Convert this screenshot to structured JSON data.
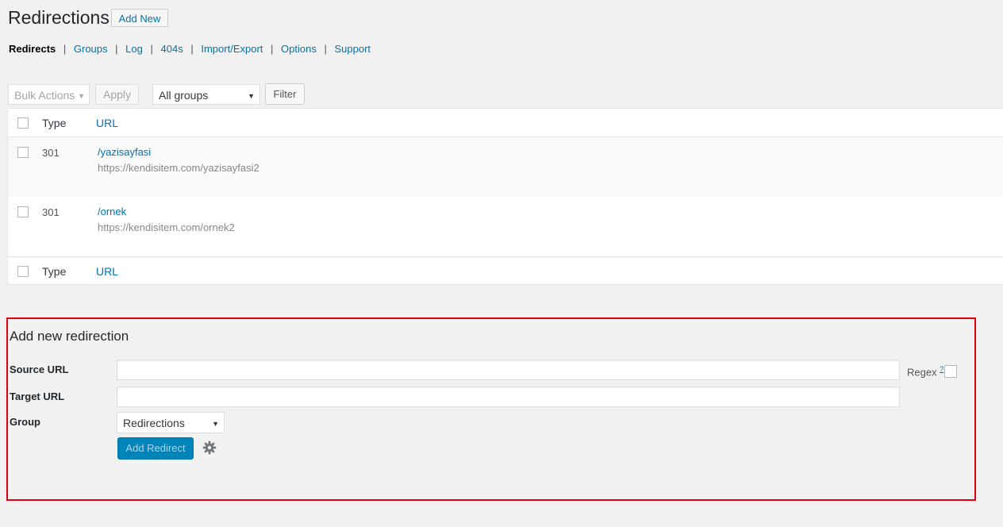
{
  "header": {
    "title": "Redirections",
    "add_new_label": "Add New"
  },
  "subnav": {
    "current": "Redirects",
    "links": [
      "Groups",
      "Log",
      "404s",
      "Import/Export",
      "Options",
      "Support"
    ],
    "separator": "|"
  },
  "tablenav": {
    "bulk_actions": "Bulk Actions",
    "apply_label": "Apply",
    "groups_selected": "All groups",
    "filter_label": "Filter"
  },
  "table": {
    "columns": {
      "type": "Type",
      "url": "URL"
    },
    "rows": [
      {
        "type": "301",
        "source": "/yazisayfasi",
        "target": "https://kendisitem.com/yazisayfasi2"
      },
      {
        "type": "301",
        "source": "/ornek",
        "target": "https://kendisitem.com/ornek2"
      }
    ]
  },
  "add_form": {
    "title": "Add new redirection",
    "source_label": "Source URL",
    "target_label": "Target URL",
    "group_label": "Group",
    "regex_label": "Regex",
    "regex_help": "?",
    "group_selected": "Redirections",
    "submit_label": "Add Redirect",
    "source_value": "",
    "target_value": ""
  },
  "icons": {
    "dropdown": "chevron-down-icon",
    "settings": "gear-icon"
  },
  "colors": {
    "link": "#0073aa",
    "primary_button": "#0085ba",
    "highlight_border": "#e0000d",
    "background": "#f1f1f1"
  }
}
